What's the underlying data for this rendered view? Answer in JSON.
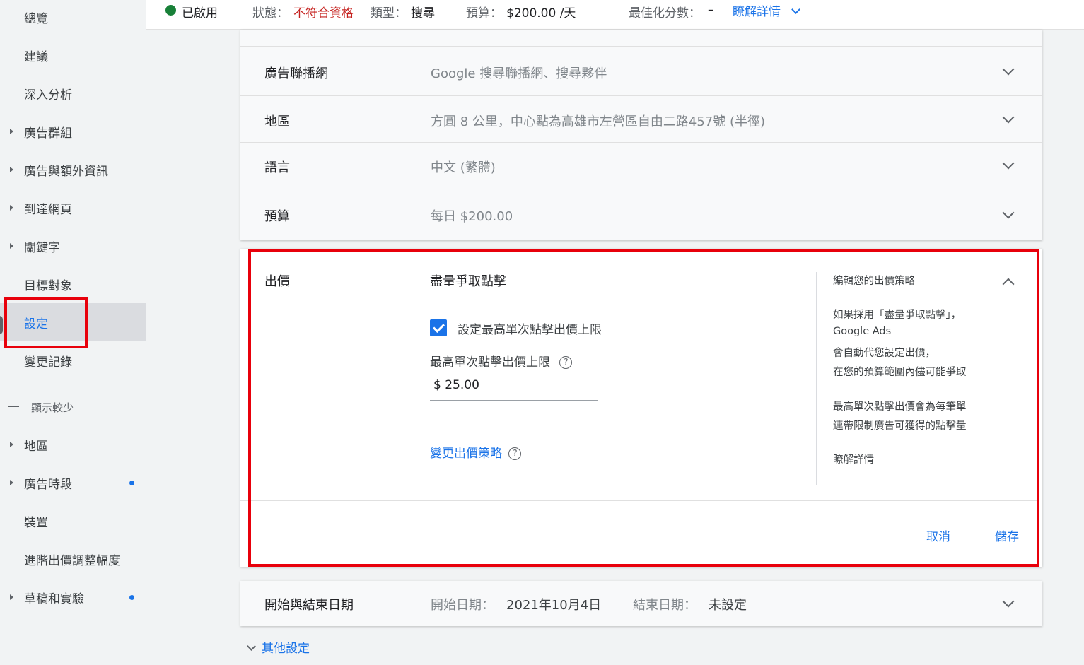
{
  "sidebar": {
    "items": [
      {
        "label": "總覽"
      },
      {
        "label": "建議"
      },
      {
        "label": "深入分析"
      },
      {
        "label": "廣告群組"
      },
      {
        "label": "廣告與額外資訊"
      },
      {
        "label": "到達網頁"
      },
      {
        "label": "關鍵字"
      },
      {
        "label": "目標對象"
      },
      {
        "label": "設定"
      },
      {
        "label": "變更記錄"
      }
    ],
    "show_less": "顯示較少",
    "more_items": [
      {
        "label": "地區"
      },
      {
        "label": "廣告時段"
      },
      {
        "label": "裝置"
      },
      {
        "label": "進階出價調整幅度"
      },
      {
        "label": "草稿和實驗"
      }
    ]
  },
  "status_bar": {
    "enabled": "已啟用",
    "status_label": "狀態：",
    "status_value": "不符合資格",
    "type_label": "類型：",
    "type_value": "搜尋",
    "budget_label": "預算：",
    "budget_value": "$200.00 /天",
    "score_label": "最佳化分數：",
    "score_value": "–",
    "learn_more": "瞭解詳情"
  },
  "settings": {
    "network": {
      "name": "廣告聯播網",
      "value": "Google 搜尋聯播網、搜尋夥伴"
    },
    "location": {
      "name": "地區",
      "value": "方圓 8 公里，中心點為高雄市左營區自由二路457號 (半徑)"
    },
    "language": {
      "name": "語言",
      "value": "中文 (繁體)"
    },
    "budget": {
      "name": "預算",
      "value": "每日 $200.00"
    }
  },
  "bidding": {
    "name": "出價",
    "strategy": "盡量爭取點擊",
    "checkbox_label": "設定最高單次點擊出價上限",
    "max_cpc_label": "最高單次點擊出價上限",
    "max_cpc_value": "$ 25.00",
    "change_strategy": "變更出價策略",
    "help_title": "編輯您的出價策略",
    "help_lines": [
      "如果採用「盡量爭取點擊」，",
      "Google Ads",
      "會自動代您設定出價，",
      "在您的預算範圍內儘可能爭取"
    ],
    "help_lines2": [
      "最高單次點擊出價會為每筆單",
      "連帶限制廣告可獲得的點擊量"
    ],
    "help_link": "瞭解詳情",
    "cancel": "取消",
    "save": "儲存"
  },
  "dates": {
    "name": "開始與結束日期",
    "start_label": "開始日期：",
    "start_value": "2021年10月4日",
    "end_label": "結束日期：",
    "end_value": "未設定"
  },
  "more_settings": "其他設定",
  "icons": {
    "help": "?"
  },
  "colors": {
    "accent": "#1a73e8",
    "highlight": "#e8000b",
    "enabled": "#188038",
    "warning": "#c5221f"
  }
}
